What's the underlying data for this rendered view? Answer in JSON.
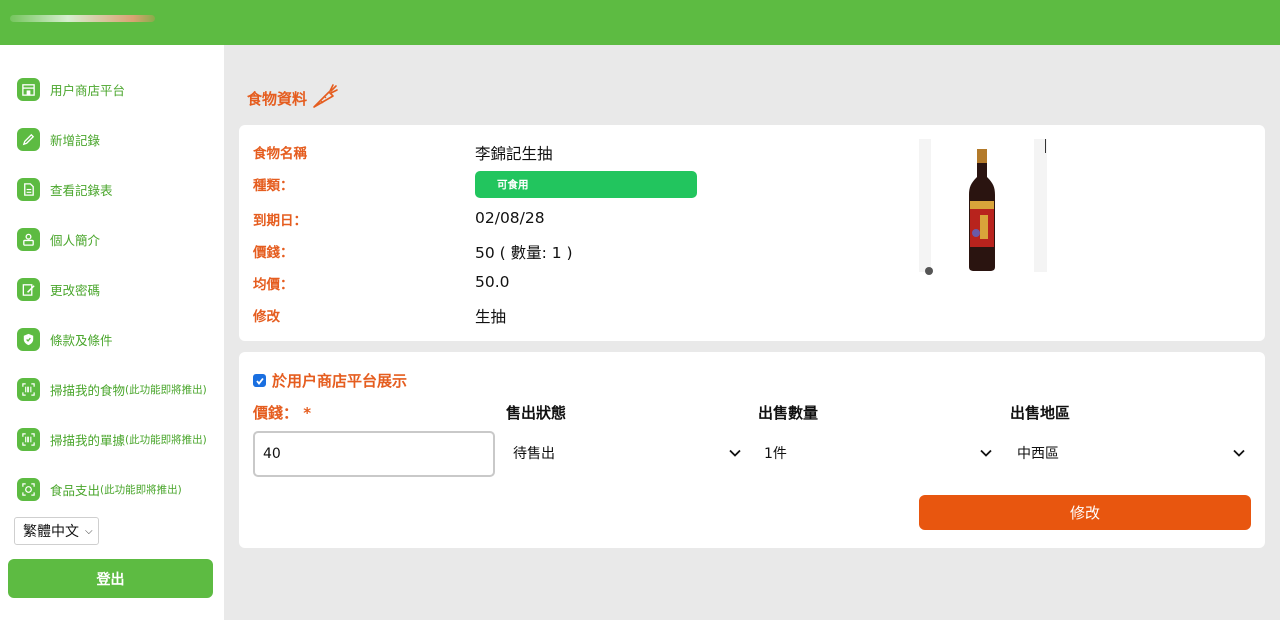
{
  "sidebar": {
    "items": [
      {
        "label": "用户商店平台",
        "note": "",
        "icon": "store-icon"
      },
      {
        "label": "新增記錄",
        "note": "",
        "icon": "pencil-icon"
      },
      {
        "label": "查看記錄表",
        "note": "",
        "icon": "document-icon"
      },
      {
        "label": "個人簡介",
        "note": "",
        "icon": "profile-icon"
      },
      {
        "label": "更改密碼",
        "note": "",
        "icon": "edit-password-icon"
      },
      {
        "label": "條款及條件",
        "note": "",
        "icon": "shield-icon"
      },
      {
        "label": "掃描我的食物",
        "note": "(此功能即將推出)",
        "icon": "barcode-icon"
      },
      {
        "label": "掃描我的單據",
        "note": "(此功能即將推出)",
        "icon": "barcode-icon"
      },
      {
        "label": "食品支出",
        "note": "(此功能即將推出)",
        "icon": "plate-icon"
      }
    ],
    "language": "繁體中文",
    "logout": "登出"
  },
  "page": {
    "title": "食物資料",
    "title_icon": "carrot-icon"
  },
  "food": {
    "name_label": "食物名稱",
    "name": "李錦記生抽",
    "category_label": "種類：",
    "category": "可食用",
    "expiry_label": "到期日：",
    "expiry": "02/08/28",
    "price_label": "價錢：",
    "price": "50 ( 數量: 1 )",
    "avg_label": "均價：",
    "avg": "50.0",
    "remark_label": "修改",
    "remark": "生抽"
  },
  "listing": {
    "checkbox_label": "於用户商店平台展示",
    "checked": true,
    "price_label": "價錢：",
    "required_mark": "*",
    "price_value": "40",
    "status_label": "售出狀態",
    "status_value": "待售出",
    "qty_label": "出售數量",
    "qty_value": "1件",
    "region_label": "出售地區",
    "region_value": "中西區",
    "submit_label": "修改"
  },
  "colors": {
    "brand_green": "#5dbb42",
    "accent_orange": "#e55d1f",
    "tag_green": "#22c55e",
    "button_orange": "#e8560f"
  }
}
